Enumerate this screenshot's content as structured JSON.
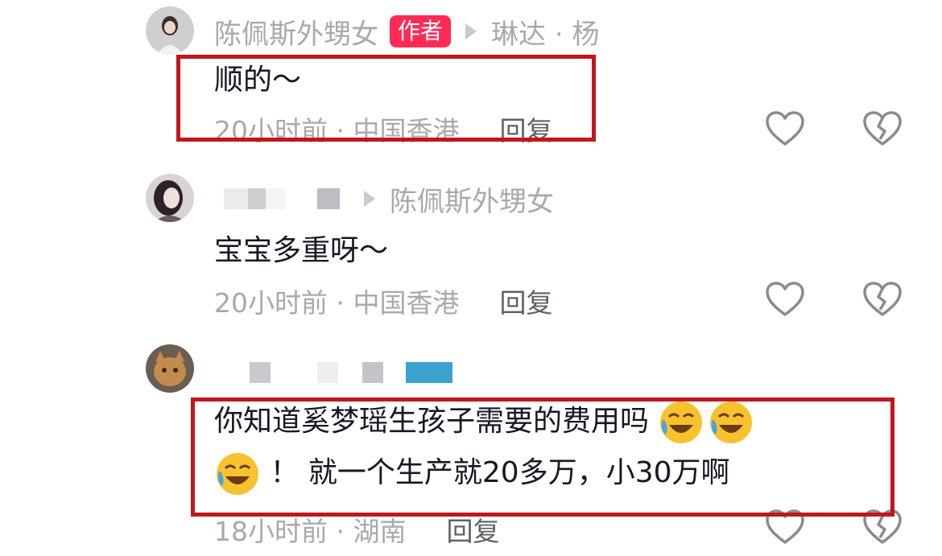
{
  "comments": [
    {
      "username": "陈佩斯外甥女",
      "author_badge": "作者",
      "reply_to": "琳达 · 杨",
      "text": "顺的～",
      "time_location": "20小时前 · 中国香港",
      "reply_label": "回复"
    },
    {
      "username": "",
      "reply_to": "陈佩斯外甥女",
      "text": "宝宝多重呀～",
      "time_location": "20小时前 · 中国香港",
      "reply_label": "回复"
    },
    {
      "username": "",
      "text_line1": "你知道奚梦瑶生孩子需要的费用吗",
      "text_line2": "！ 就一个生产就20多万，小30万啊",
      "time_location": "18小时前 · 湖南",
      "reply_label": "回复"
    }
  ],
  "icons": {
    "like": "heart-outline-icon",
    "dislike": "broken-heart-icon",
    "reply_arrow": "triangle-right-icon",
    "emoji": "rolling-laughing-emoji-icon"
  },
  "colors": {
    "author_badge": "#fe2c55",
    "highlight_box": "#c0171c",
    "meta_text": "#a8a9ae"
  }
}
